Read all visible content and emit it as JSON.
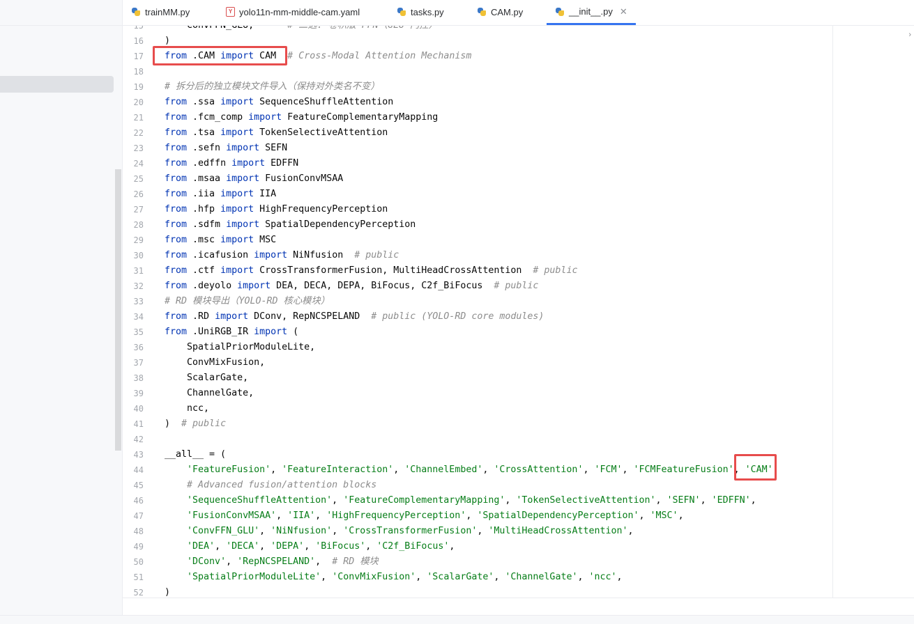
{
  "tabs": [
    {
      "label": "trainMM.py",
      "icon": "python-file-icon"
    },
    {
      "label": "yolo11n-mm-middle-cam.yaml",
      "icon": "yaml-file-icon"
    },
    {
      "label": "tasks.py",
      "icon": "python-file-icon"
    },
    {
      "label": "CAM.py",
      "icon": "python-file-icon"
    },
    {
      "label": "__init__.py",
      "icon": "python-file-icon",
      "active": true
    }
  ],
  "collapse_glyph": "›",
  "editor": {
    "lines": [
      {
        "n": "15",
        "segments": [
          {
            "t": "    ConvFFN_GLU,      ",
            "c": "p"
          },
          {
            "t": "# 二选: 卷积版 FFN（GLU 门控）",
            "c": "cm"
          }
        ]
      },
      {
        "n": "16",
        "segments": [
          {
            "t": ")",
            "c": "p"
          }
        ]
      },
      {
        "n": "17",
        "segments": [
          {
            "t": "from",
            "c": "kw"
          },
          {
            "t": " .CAM ",
            "c": "p"
          },
          {
            "t": "import",
            "c": "kw"
          },
          {
            "t": " CAM  ",
            "c": "p"
          },
          {
            "t": "# Cross-Modal Attention Mechanism",
            "c": "cm"
          }
        ]
      },
      {
        "n": "18",
        "segments": []
      },
      {
        "n": "19",
        "segments": [
          {
            "t": "# 拆分后的独立模块文件导入（保持对外类名不变）",
            "c": "cm"
          }
        ]
      },
      {
        "n": "20",
        "segments": [
          {
            "t": "from",
            "c": "kw"
          },
          {
            "t": " .ssa ",
            "c": "p"
          },
          {
            "t": "import",
            "c": "kw"
          },
          {
            "t": " SequenceShuffleAttention",
            "c": "p"
          }
        ]
      },
      {
        "n": "21",
        "segments": [
          {
            "t": "from",
            "c": "kw"
          },
          {
            "t": " .fcm_comp ",
            "c": "p"
          },
          {
            "t": "import",
            "c": "kw"
          },
          {
            "t": " FeatureComplementaryMapping",
            "c": "p"
          }
        ]
      },
      {
        "n": "22",
        "segments": [
          {
            "t": "from",
            "c": "kw"
          },
          {
            "t": " .tsa ",
            "c": "p"
          },
          {
            "t": "import",
            "c": "kw"
          },
          {
            "t": " TokenSelectiveAttention",
            "c": "p"
          }
        ]
      },
      {
        "n": "23",
        "segments": [
          {
            "t": "from",
            "c": "kw"
          },
          {
            "t": " .sefn ",
            "c": "p"
          },
          {
            "t": "import",
            "c": "kw"
          },
          {
            "t": " SEFN",
            "c": "p"
          }
        ]
      },
      {
        "n": "24",
        "segments": [
          {
            "t": "from",
            "c": "kw"
          },
          {
            "t": " .edffn ",
            "c": "p"
          },
          {
            "t": "import",
            "c": "kw"
          },
          {
            "t": " EDFFN",
            "c": "p"
          }
        ]
      },
      {
        "n": "25",
        "segments": [
          {
            "t": "from",
            "c": "kw"
          },
          {
            "t": " .msaa ",
            "c": "p"
          },
          {
            "t": "import",
            "c": "kw"
          },
          {
            "t": " FusionConvMSAA",
            "c": "p"
          }
        ]
      },
      {
        "n": "26",
        "segments": [
          {
            "t": "from",
            "c": "kw"
          },
          {
            "t": " .iia ",
            "c": "p"
          },
          {
            "t": "import",
            "c": "kw"
          },
          {
            "t": " IIA",
            "c": "p"
          }
        ]
      },
      {
        "n": "27",
        "segments": [
          {
            "t": "from",
            "c": "kw"
          },
          {
            "t": " .hfp ",
            "c": "p"
          },
          {
            "t": "import",
            "c": "kw"
          },
          {
            "t": " HighFrequencyPerception",
            "c": "p"
          }
        ]
      },
      {
        "n": "28",
        "segments": [
          {
            "t": "from",
            "c": "kw"
          },
          {
            "t": " .sdfm ",
            "c": "p"
          },
          {
            "t": "import",
            "c": "kw"
          },
          {
            "t": " SpatialDependencyPerception",
            "c": "p"
          }
        ]
      },
      {
        "n": "29",
        "segments": [
          {
            "t": "from",
            "c": "kw"
          },
          {
            "t": " .msc ",
            "c": "p"
          },
          {
            "t": "import",
            "c": "kw"
          },
          {
            "t": " MSC",
            "c": "p"
          }
        ]
      },
      {
        "n": "30",
        "segments": [
          {
            "t": "from",
            "c": "kw"
          },
          {
            "t": " .icafusion ",
            "c": "p"
          },
          {
            "t": "import",
            "c": "kw"
          },
          {
            "t": " NiNfusion  ",
            "c": "p"
          },
          {
            "t": "# public",
            "c": "cm"
          }
        ]
      },
      {
        "n": "31",
        "segments": [
          {
            "t": "from",
            "c": "kw"
          },
          {
            "t": " .ctf ",
            "c": "p"
          },
          {
            "t": "import",
            "c": "kw"
          },
          {
            "t": " CrossTransformerFusion, MultiHeadCrossAttention  ",
            "c": "p"
          },
          {
            "t": "# public",
            "c": "cm"
          }
        ]
      },
      {
        "n": "32",
        "segments": [
          {
            "t": "from",
            "c": "kw"
          },
          {
            "t": " .deyolo ",
            "c": "p"
          },
          {
            "t": "import",
            "c": "kw"
          },
          {
            "t": " DEA, DECA, DEPA, BiFocus, C2f_BiFocus  ",
            "c": "p"
          },
          {
            "t": "# public",
            "c": "cm"
          }
        ]
      },
      {
        "n": "33",
        "segments": [
          {
            "t": "# RD 模块导出（YOLO-RD 核心模块）",
            "c": "cm"
          }
        ]
      },
      {
        "n": "34",
        "segments": [
          {
            "t": "from",
            "c": "kw"
          },
          {
            "t": " .RD ",
            "c": "p"
          },
          {
            "t": "import",
            "c": "kw"
          },
          {
            "t": " DConv, RepNCSPELAND  ",
            "c": "p"
          },
          {
            "t": "# public (YOLO-RD core modules)",
            "c": "cm"
          }
        ]
      },
      {
        "n": "35",
        "segments": [
          {
            "t": "from",
            "c": "kw"
          },
          {
            "t": " .UniRGB_IR ",
            "c": "p"
          },
          {
            "t": "import",
            "c": "kw"
          },
          {
            "t": " (",
            "c": "p"
          }
        ]
      },
      {
        "n": "36",
        "segments": [
          {
            "t": "    SpatialPriorModuleLite,",
            "c": "p"
          }
        ]
      },
      {
        "n": "37",
        "segments": [
          {
            "t": "    ConvMixFusion,",
            "c": "p"
          }
        ]
      },
      {
        "n": "38",
        "segments": [
          {
            "t": "    ScalarGate,",
            "c": "p"
          }
        ]
      },
      {
        "n": "39",
        "segments": [
          {
            "t": "    ChannelGate,",
            "c": "p"
          }
        ]
      },
      {
        "n": "40",
        "segments": [
          {
            "t": "    ncc,",
            "c": "p"
          }
        ]
      },
      {
        "n": "41",
        "segments": [
          {
            "t": ")  ",
            "c": "p"
          },
          {
            "t": "# public",
            "c": "cm"
          }
        ]
      },
      {
        "n": "42",
        "segments": []
      },
      {
        "n": "43",
        "segments": [
          {
            "t": "__all__ = (",
            "c": "p"
          }
        ]
      },
      {
        "n": "44",
        "segments": [
          {
            "t": "    ",
            "c": "p"
          },
          {
            "t": "'FeatureFusion'",
            "c": "str"
          },
          {
            "t": ", ",
            "c": "p"
          },
          {
            "t": "'FeatureInteraction'",
            "c": "str"
          },
          {
            "t": ", ",
            "c": "p"
          },
          {
            "t": "'ChannelEmbed'",
            "c": "str"
          },
          {
            "t": ", ",
            "c": "p"
          },
          {
            "t": "'CrossAttention'",
            "c": "str"
          },
          {
            "t": ", ",
            "c": "p"
          },
          {
            "t": "'FCM'",
            "c": "str"
          },
          {
            "t": ", ",
            "c": "p"
          },
          {
            "t": "'FCMFeatureFusion'",
            "c": "str"
          },
          {
            "t": ", ",
            "c": "p"
          },
          {
            "t": "'CAM'",
            "c": "str"
          },
          {
            "t": ",",
            "c": "p"
          }
        ]
      },
      {
        "n": "45",
        "segments": [
          {
            "t": "    ",
            "c": "p"
          },
          {
            "t": "# Advanced fusion/attention blocks",
            "c": "cm"
          }
        ]
      },
      {
        "n": "46",
        "segments": [
          {
            "t": "    ",
            "c": "p"
          },
          {
            "t": "'SequenceShuffleAttention'",
            "c": "str"
          },
          {
            "t": ", ",
            "c": "p"
          },
          {
            "t": "'FeatureComplementaryMapping'",
            "c": "str"
          },
          {
            "t": ", ",
            "c": "p"
          },
          {
            "t": "'TokenSelectiveAttention'",
            "c": "str"
          },
          {
            "t": ", ",
            "c": "p"
          },
          {
            "t": "'SEFN'",
            "c": "str"
          },
          {
            "t": ", ",
            "c": "p"
          },
          {
            "t": "'EDFFN'",
            "c": "str"
          },
          {
            "t": ",",
            "c": "p"
          }
        ]
      },
      {
        "n": "47",
        "segments": [
          {
            "t": "    ",
            "c": "p"
          },
          {
            "t": "'FusionConvMSAA'",
            "c": "str"
          },
          {
            "t": ", ",
            "c": "p"
          },
          {
            "t": "'IIA'",
            "c": "str"
          },
          {
            "t": ", ",
            "c": "p"
          },
          {
            "t": "'HighFrequencyPerception'",
            "c": "str"
          },
          {
            "t": ", ",
            "c": "p"
          },
          {
            "t": "'SpatialDependencyPerception'",
            "c": "str"
          },
          {
            "t": ", ",
            "c": "p"
          },
          {
            "t": "'MSC'",
            "c": "str"
          },
          {
            "t": ",",
            "c": "p"
          }
        ]
      },
      {
        "n": "48",
        "segments": [
          {
            "t": "    ",
            "c": "p"
          },
          {
            "t": "'ConvFFN_GLU'",
            "c": "str"
          },
          {
            "t": ", ",
            "c": "p"
          },
          {
            "t": "'NiNfusion'",
            "c": "str"
          },
          {
            "t": ", ",
            "c": "p"
          },
          {
            "t": "'CrossTransformerFusion'",
            "c": "str"
          },
          {
            "t": ", ",
            "c": "p"
          },
          {
            "t": "'MultiHeadCrossAttention'",
            "c": "str"
          },
          {
            "t": ",",
            "c": "p"
          }
        ]
      },
      {
        "n": "49",
        "segments": [
          {
            "t": "    ",
            "c": "p"
          },
          {
            "t": "'DEA'",
            "c": "str"
          },
          {
            "t": ", ",
            "c": "p"
          },
          {
            "t": "'DECA'",
            "c": "str"
          },
          {
            "t": ", ",
            "c": "p"
          },
          {
            "t": "'DEPA'",
            "c": "str"
          },
          {
            "t": ", ",
            "c": "p"
          },
          {
            "t": "'BiFocus'",
            "c": "str"
          },
          {
            "t": ", ",
            "c": "p"
          },
          {
            "t": "'C2f_BiFocus'",
            "c": "str"
          },
          {
            "t": ",",
            "c": "p"
          }
        ]
      },
      {
        "n": "50",
        "segments": [
          {
            "t": "    ",
            "c": "p"
          },
          {
            "t": "'DConv'",
            "c": "str"
          },
          {
            "t": ", ",
            "c": "p"
          },
          {
            "t": "'RepNCSPELAND'",
            "c": "str"
          },
          {
            "t": ",  ",
            "c": "p"
          },
          {
            "t": "# RD 模块",
            "c": "cm"
          }
        ]
      },
      {
        "n": "51",
        "segments": [
          {
            "t": "    ",
            "c": "p"
          },
          {
            "t": "'SpatialPriorModuleLite'",
            "c": "str"
          },
          {
            "t": ", ",
            "c": "p"
          },
          {
            "t": "'ConvMixFusion'",
            "c": "str"
          },
          {
            "t": ", ",
            "c": "p"
          },
          {
            "t": "'ScalarGate'",
            "c": "str"
          },
          {
            "t": ", ",
            "c": "p"
          },
          {
            "t": "'ChannelGate'",
            "c": "str"
          },
          {
            "t": ", ",
            "c": "p"
          },
          {
            "t": "'ncc'",
            "c": "str"
          },
          {
            "t": ",",
            "c": "p"
          }
        ]
      },
      {
        "n": "52",
        "segments": [
          {
            "t": ")",
            "c": "p"
          }
        ]
      }
    ]
  },
  "colors": {
    "keyword": "#0033b3",
    "comment": "#8c8c8c",
    "string": "#067d17",
    "highlight": "#e74c4c",
    "accent": "#3574f0"
  }
}
